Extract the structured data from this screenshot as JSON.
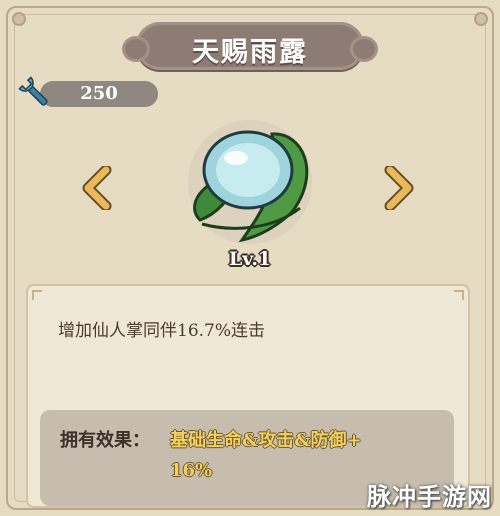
{
  "title": "天赐雨露",
  "currency": {
    "icon": "wrench-icon",
    "value": "250"
  },
  "item": {
    "icon": "dewdrop-leaf-icon",
    "level": "Lv.1"
  },
  "description": "增加仙人掌同伴16.7%连击",
  "effect": {
    "label": "拥有效果：",
    "line1": "基础生命&攻击&防御+",
    "line2": "16%"
  },
  "watermark": "脉冲手游网",
  "colors": {
    "banner": "#8d7c73",
    "arrow": "#e8b95a",
    "effect_value": "#f2d25c"
  }
}
